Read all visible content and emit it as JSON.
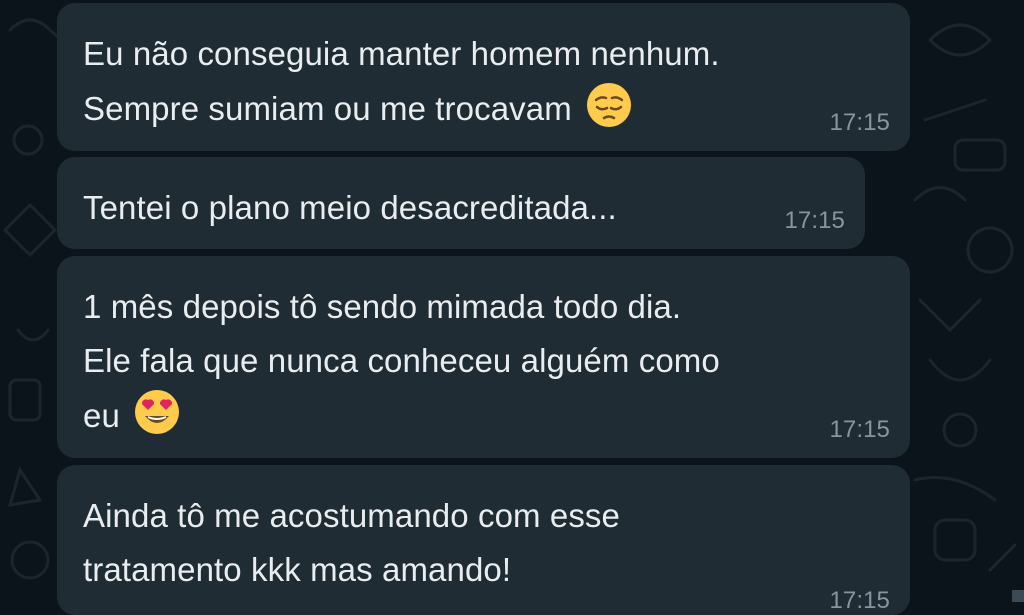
{
  "messages": [
    {
      "lines": [
        "Eu não conseguia manter homem nenhum.",
        "Sempre sumiam ou me trocavam"
      ],
      "emoji": "pensive-face-icon",
      "time": "17:15"
    },
    {
      "lines": [
        "Tentei o plano meio desacreditada..."
      ],
      "emoji": null,
      "time": "17:15"
    },
    {
      "lines": [
        "1 mês depois tô sendo mimada todo dia.",
        "Ele fala que nunca conheceu alguém como",
        "eu"
      ],
      "emoji": "heart-eyes-face-icon",
      "time": "17:15"
    },
    {
      "lines": [
        "Ainda tô me acostumando com esse",
        "tratamento kkk mas amando!"
      ],
      "emoji": null,
      "time": "17:15"
    }
  ],
  "colors": {
    "background": "#0b141a",
    "bubble": "#202c33",
    "text": "#e9edef",
    "timestamp": "#8696a0",
    "emoji_yellow": "#ffcb4c"
  }
}
